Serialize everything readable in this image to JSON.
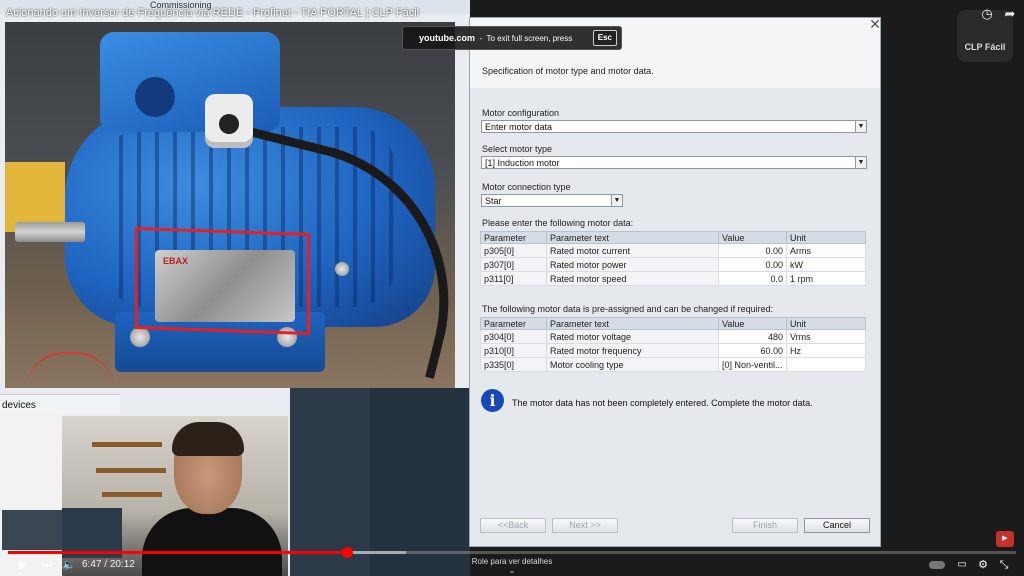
{
  "video": {
    "title": "Acionando um Inversor de Frequência via REDE - Profinet - TIA PORTAL | CLP Fácil",
    "channel_logo_text": "CLP Fácil",
    "fullscreen_toast": {
      "site": "youtube.com",
      "message": "To exit full screen, press",
      "key": "Esc"
    },
    "time_current": "6:47",
    "time_separator": "/",
    "time_total": "20:12",
    "progress_fraction": 0.336,
    "buffer_fraction": 0.395,
    "scroll_hint": "Role para ver detalhes",
    "accent_color": "#ff0000"
  },
  "tia": {
    "commissioning_label": "Commissioning",
    "devices_label": "devices"
  },
  "photo": {
    "nameplate_brand": "EBAX"
  },
  "dialog": {
    "spec_text": "Specification of motor type and motor data.",
    "motor_configuration": {
      "label": "Motor configuration",
      "value": "Enter motor data"
    },
    "motor_type": {
      "label": "Select motor type",
      "value": "[1] Induction motor"
    },
    "connection_type": {
      "label": "Motor connection type",
      "value": "Star"
    },
    "enter_data_label": "Please enter the following motor data:",
    "columns": [
      "Parameter",
      "Parameter text",
      "Value",
      "Unit"
    ],
    "motor_data": [
      {
        "param": "p305[0]",
        "text": "Rated motor current",
        "value": "0.00",
        "unit": "Arms"
      },
      {
        "param": "p307[0]",
        "text": "Rated motor power",
        "value": "0.00",
        "unit": "kW"
      },
      {
        "param": "p311[0]",
        "text": "Rated motor speed",
        "value": "0.0",
        "unit": "1 rpm"
      }
    ],
    "preassigned_label": "The following motor data is pre-assigned and can be changed if required:",
    "preassigned_data": [
      {
        "param": "p304[0]",
        "text": "Rated motor voltage",
        "value": "480",
        "unit": "Vrms"
      },
      {
        "param": "p310[0]",
        "text": "Rated motor frequency",
        "value": "60.00",
        "unit": "Hz"
      },
      {
        "param": "p335[0]",
        "text": "Motor cooling type",
        "value": "[0] Non-ventil...",
        "unit": ""
      }
    ],
    "info_message": "The motor data has not been completely entered. Complete the motor data.",
    "buttons": {
      "back": "<<Back",
      "next": "Next >>",
      "finish": "Finish",
      "cancel": "Cancel"
    },
    "info_icon_color": "#1747b8"
  }
}
